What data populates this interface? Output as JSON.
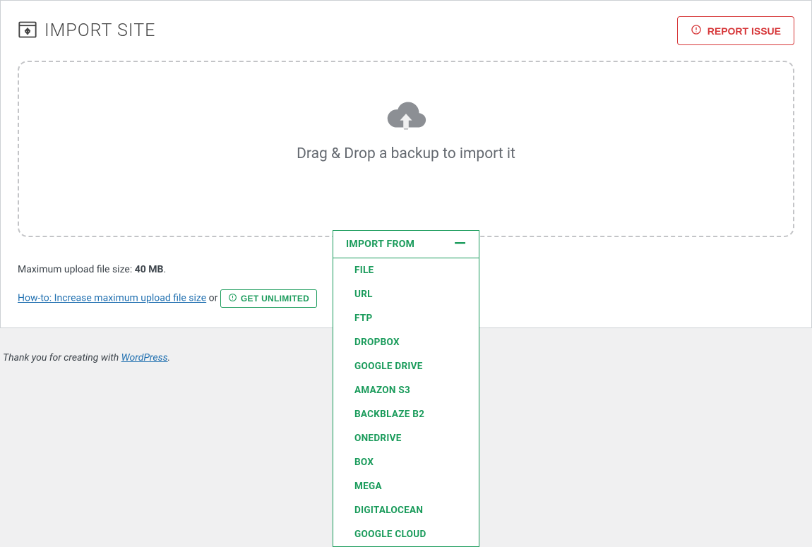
{
  "header": {
    "title": "IMPORT SITE",
    "report_button": "REPORT ISSUE"
  },
  "dropzone": {
    "text": "Drag & Drop a backup to import it"
  },
  "import_from": {
    "button_label": "IMPORT FROM",
    "toggle_glyph": "—",
    "options": [
      "FILE",
      "URL",
      "FTP",
      "DROPBOX",
      "GOOGLE DRIVE",
      "AMAZON S3",
      "BACKBLAZE B2",
      "ONEDRIVE",
      "BOX",
      "MEGA",
      "DIGITALOCEAN",
      "GOOGLE CLOUD"
    ]
  },
  "upload_info": {
    "prefix": "Maximum upload file size: ",
    "size": "40 MB",
    "suffix": "."
  },
  "howto": {
    "link_text": "How-to: Increase maximum upload file size",
    "or": " or ",
    "unlimited_label": "GET UNLIMITED"
  },
  "footer": {
    "prefix": "Thank you for creating with ",
    "link_text": "WordPress",
    "suffix": "."
  }
}
